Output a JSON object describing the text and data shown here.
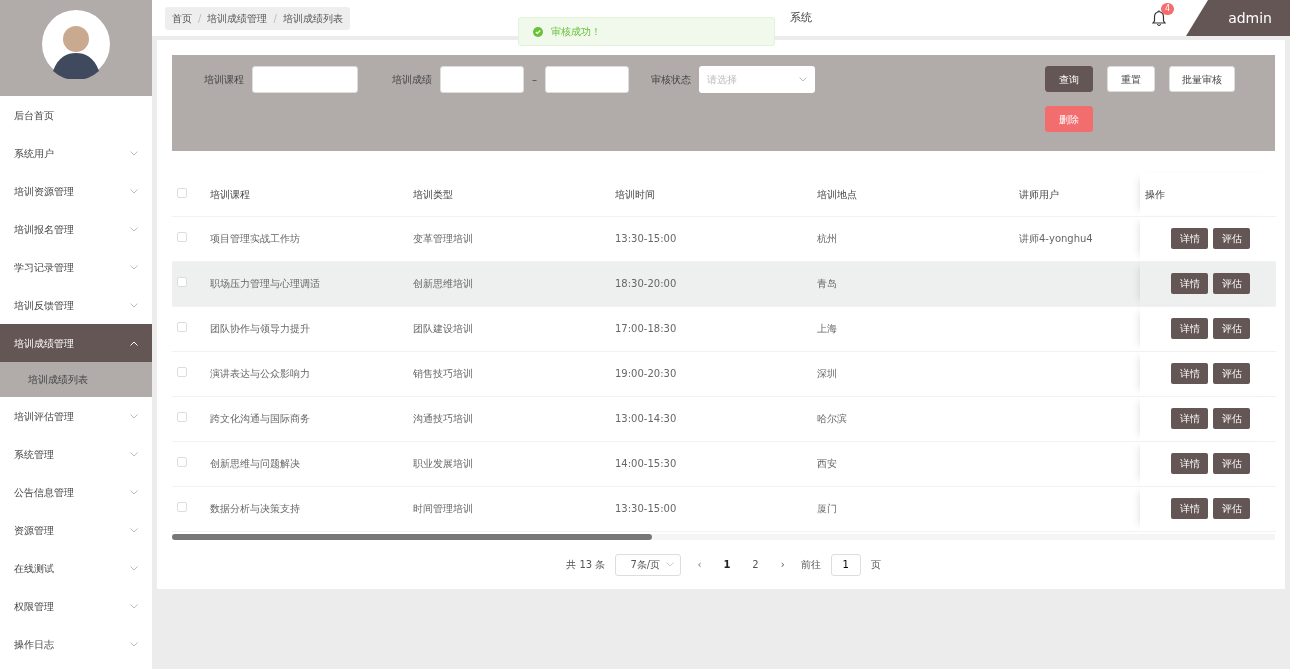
{
  "header": {
    "breadcrumb": [
      {
        "label": "首页"
      },
      {
        "label": "培训成绩管理"
      },
      {
        "label": "培训成绩列表"
      }
    ],
    "breadcrumb_separators": [
      "/",
      "/"
    ],
    "title": "系统",
    "notifications": "4",
    "user": "admin"
  },
  "toast": {
    "message": "审核成功！"
  },
  "sidebar": {
    "items": [
      {
        "label": "后台首页",
        "kind": "link",
        "expanded": false
      },
      {
        "label": "系统用户",
        "kind": "menu",
        "expanded": false
      },
      {
        "label": "培训资源管理",
        "kind": "menu",
        "expanded": false
      },
      {
        "label": "培训报名管理",
        "kind": "menu",
        "expanded": false
      },
      {
        "label": "学习记录管理",
        "kind": "menu",
        "expanded": false
      },
      {
        "label": "培训反馈管理",
        "kind": "menu",
        "expanded": false
      },
      {
        "label": "培训成绩管理",
        "kind": "menu",
        "expanded": true,
        "children": [
          {
            "label": "培训成绩列表",
            "selected": true
          }
        ]
      },
      {
        "label": "培训评估管理",
        "kind": "menu",
        "expanded": false
      },
      {
        "label": "系统管理",
        "kind": "menu",
        "expanded": false
      },
      {
        "label": "公告信息管理",
        "kind": "menu",
        "expanded": false
      },
      {
        "label": "资源管理",
        "kind": "menu",
        "expanded": false
      },
      {
        "label": "在线测试",
        "kind": "menu",
        "expanded": false
      },
      {
        "label": "权限管理",
        "kind": "menu",
        "expanded": false
      },
      {
        "label": "操作日志",
        "kind": "menu",
        "expanded": false
      }
    ]
  },
  "search": {
    "course_label": "培训课程",
    "score_label": "培训成绩",
    "range_separator": "–",
    "status_label": "审核状态",
    "status_placeholder": "请选择",
    "buttons": [
      {
        "label": "查询",
        "kind": "primary"
      },
      {
        "label": "重置",
        "kind": "plain"
      },
      {
        "label": "批量审核",
        "kind": "plain"
      },
      {
        "label": "删除",
        "kind": "danger"
      }
    ]
  },
  "table": {
    "all_checked": false,
    "columns": [
      "培训课程",
      "培训类型",
      "培训时间",
      "培训地点",
      "讲师用户",
      "操作"
    ],
    "rows": [
      {
        "cells": [
          "项目管理实战工作坊",
          "变革管理培训",
          "13:30-15:00",
          "杭州",
          "讲师4-yonghu4"
        ],
        "checked": false,
        "hovered": false,
        "actions": [
          "详情",
          "评估"
        ]
      },
      {
        "cells": [
          "职场压力管理与心理调适",
          "创新思维培训",
          "18:30-20:00",
          "青岛",
          ""
        ],
        "checked": false,
        "hovered": true,
        "actions": [
          "详情",
          "评估"
        ]
      },
      {
        "cells": [
          "团队协作与领导力提升",
          "团队建设培训",
          "17:00-18:30",
          "上海",
          ""
        ],
        "checked": false,
        "hovered": false,
        "actions": [
          "详情",
          "评估"
        ]
      },
      {
        "cells": [
          "演讲表达与公众影响力",
          "销售技巧培训",
          "19:00-20:30",
          "深圳",
          ""
        ],
        "checked": false,
        "hovered": false,
        "actions": [
          "详情",
          "评估"
        ]
      },
      {
        "cells": [
          "跨文化沟通与国际商务",
          "沟通技巧培训",
          "13:00-14:30",
          "哈尔滨",
          ""
        ],
        "checked": false,
        "hovered": false,
        "actions": [
          "详情",
          "评估"
        ]
      },
      {
        "cells": [
          "创新思维与问题解决",
          "职业发展培训",
          "14:00-15:30",
          "西安",
          ""
        ],
        "checked": false,
        "hovered": false,
        "actions": [
          "详情",
          "评估"
        ]
      },
      {
        "cells": [
          "数据分析与决策支持",
          "时间管理培训",
          "13:30-15:00",
          "厦门",
          ""
        ],
        "checked": false,
        "hovered": false,
        "actions": [
          "详情",
          "评估"
        ]
      }
    ]
  },
  "pagination": {
    "total": "共 13 条",
    "page_size": "7条/页",
    "prev": "‹",
    "next": "›",
    "pages": [
      {
        "label": "1",
        "selected": true
      },
      {
        "label": "2",
        "selected": false
      }
    ],
    "goto_label": "前往",
    "goto_value": "1",
    "goto_suffix": "页"
  }
}
